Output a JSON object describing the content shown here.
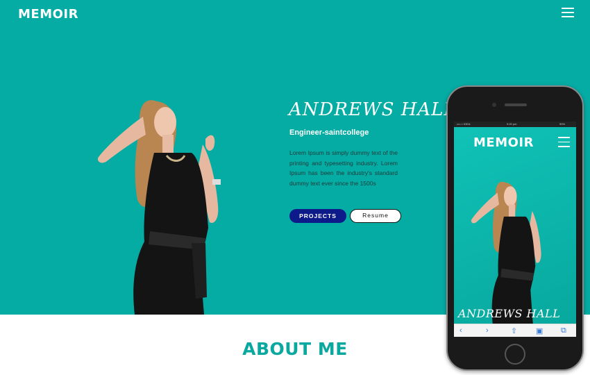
{
  "nav": {
    "brand": "MEMOIR",
    "menu_icon": "hamburger-menu-icon"
  },
  "hero": {
    "name": "ANDREWS HALL",
    "role": "Engineer-saintcollege",
    "bio": "Lorem Ipsum is simply dummy text of the printing and typesetting industry. Lorem Ipsum has been the industry's standard dummy text ever since the 1500s",
    "projects_label": "PROJECTS",
    "resume_label": "Resume"
  },
  "about": {
    "heading": "ABOUT ME"
  },
  "phone": {
    "status_carrier": "•••○○ IDEA",
    "status_time": "9:20 pm",
    "status_battery": "90%",
    "brand": "MEMOIR",
    "name": "ANDREWS HALL",
    "browser_icons": [
      "back-icon",
      "forward-icon",
      "share-icon",
      "bookmarks-icon",
      "tabs-icon"
    ]
  },
  "colors": {
    "teal": "#04aca4",
    "navy_button": "#0d1a8a",
    "dress": "#141414",
    "hair": "#b98550"
  }
}
